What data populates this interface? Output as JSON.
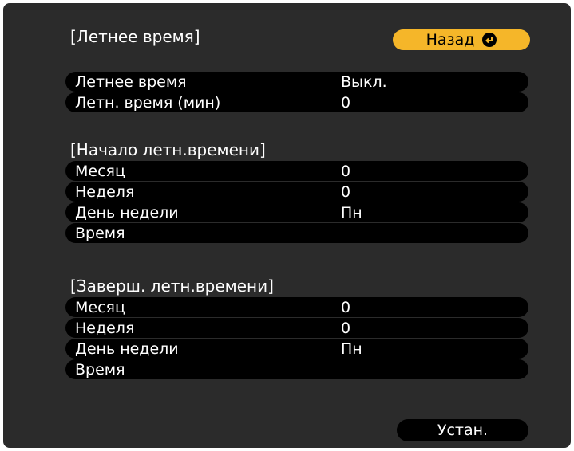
{
  "title": "[Летнее время]",
  "back_label": "Назад",
  "main_rows": [
    {
      "label": "Летнее время",
      "value": "Выкл."
    },
    {
      "label": "Летн. время (мин)",
      "value": "0"
    }
  ],
  "start_section": {
    "title": "[Начало летн.времени]",
    "rows": [
      {
        "label": "Месяц",
        "value": "0"
      },
      {
        "label": "Неделя",
        "value": "0"
      },
      {
        "label": "День недели",
        "value": "Пн"
      },
      {
        "label": "Время",
        "value": ""
      }
    ]
  },
  "end_section": {
    "title": "[Заверш. летн.времени]",
    "rows": [
      {
        "label": "Месяц",
        "value": "0"
      },
      {
        "label": "Неделя",
        "value": "0"
      },
      {
        "label": "День недели",
        "value": "Пн"
      },
      {
        "label": "Время",
        "value": ""
      }
    ]
  },
  "set_label": "Устан.",
  "colors": {
    "panel": "#2b2b2b",
    "row": "#000000",
    "accent": "#f5b629"
  }
}
